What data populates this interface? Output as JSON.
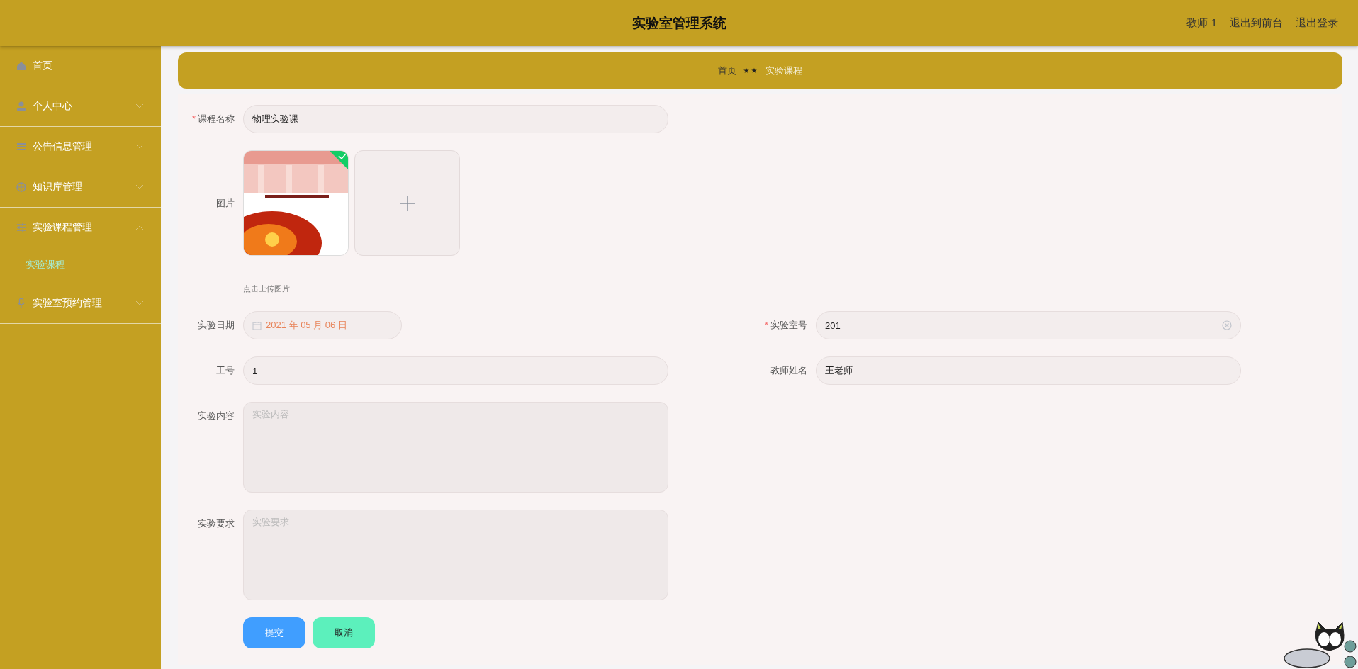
{
  "header": {
    "title": "实验室管理系统",
    "links": [
      "教师 1",
      "退出到前台",
      "退出登录"
    ]
  },
  "sidebar": {
    "items": [
      {
        "label": "首页",
        "kind": "link"
      },
      {
        "label": "个人中心",
        "kind": "submenu",
        "expanded": false
      },
      {
        "label": "公告信息管理",
        "kind": "submenu",
        "expanded": false
      },
      {
        "label": "知识库管理",
        "kind": "submenu",
        "expanded": false
      },
      {
        "label": "实验课程管理",
        "kind": "submenu",
        "expanded": true,
        "children": [
          {
            "label": "实验课程",
            "selected": true
          }
        ]
      },
      {
        "label": "实验室预约管理",
        "kind": "submenu",
        "expanded": false
      }
    ]
  },
  "breadcrumb": {
    "separator": "★★",
    "items": [
      {
        "label": "首页",
        "selected": false
      },
      {
        "label": "实验课程",
        "selected": true
      }
    ]
  },
  "form": {
    "rows": [
      [
        {
          "kind": "text",
          "label": "课程名称",
          "marker": "*",
          "value": "物理实验课"
        }
      ],
      [
        {
          "kind": "upload",
          "label": "图片",
          "files": [
            {
              "kind": "picture",
              "success": true
            }
          ],
          "hint": "点击上传图片"
        }
      ],
      [
        {
          "kind": "date",
          "label": "实验日期",
          "value": "2021 年 05 月 06 日"
        },
        {
          "kind": "text",
          "label": "实验室号",
          "marker": "*",
          "value": "201",
          "clearable": true
        }
      ],
      [
        {
          "kind": "text",
          "label": "工号",
          "value": "1"
        },
        {
          "kind": "text",
          "label": "教师姓名",
          "value": "王老师"
        }
      ],
      [
        {
          "kind": "textarea",
          "label": "实验内容",
          "placeholder": "实验内容"
        }
      ],
      [
        {
          "kind": "textarea",
          "label": "实验要求",
          "placeholder": "实验要求"
        }
      ]
    ],
    "buttons": [
      {
        "label": "提交",
        "kind": "primary"
      },
      {
        "label": "取消",
        "kind": "cancel"
      }
    ]
  }
}
